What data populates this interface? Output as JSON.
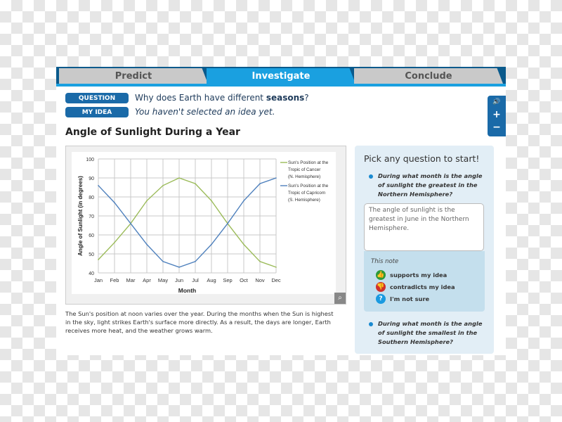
{
  "tabs": [
    {
      "label": "Predict",
      "active": false
    },
    {
      "label": "Investigate",
      "active": true
    },
    {
      "label": "Conclude",
      "active": false
    }
  ],
  "question": {
    "badge": "QUESTION",
    "text_pre": "Why does Earth have different ",
    "text_bold": "seasons",
    "text_post": "?"
  },
  "idea": {
    "badge": "MY IDEA",
    "text": "You haven't selected an idea yet."
  },
  "controls": {
    "audio": "🔊",
    "zoom_in": "+",
    "zoom_out": "−"
  },
  "section_title": "Angle of Sunlight During a Year",
  "description": "The Sun's position at noon varies over the year. During the months when the Sun is highest in the sky, light strikes Earth's surface more directly. As a result, the days are longer, Earth receives more heat, and the weather grows warm.",
  "chart_data": {
    "type": "line",
    "categories": [
      "Jan",
      "Feb",
      "Mar",
      "Apr",
      "May",
      "Jun",
      "Jul",
      "Aug",
      "Sep",
      "Oct",
      "Nov",
      "Dec"
    ],
    "xlabel": "Month",
    "ylabel": "Angle of Sunlight (in degrees)",
    "ylim": [
      40,
      100
    ],
    "yticks": [
      40,
      50,
      60,
      70,
      80,
      90,
      100
    ],
    "grid": true,
    "legend": "right",
    "series": [
      {
        "name_lines": [
          "Sun's Position at the",
          "Tropic of Cancer",
          "(N. Hemisphere)"
        ],
        "color": "#9bbb59",
        "values": [
          47,
          56,
          66,
          78,
          86,
          90,
          87,
          78,
          66,
          55,
          46,
          43
        ]
      },
      {
        "name_lines": [
          "Sun's Position at the",
          "Tropic of Capricorn",
          "(S. Hemisphere)"
        ],
        "color": "#4f81bd",
        "values": [
          86,
          77,
          66,
          55,
          46,
          43,
          46,
          55,
          66,
          78,
          87,
          90
        ]
      }
    ]
  },
  "sidebar": {
    "heading": "Pick any question to start!",
    "q1": "During what month is the angle of sunlight the greatest in the Northern Hemisphere?",
    "note": "The angle of sunlight is the greatest in June in the Northern Hemisphere.",
    "note_label": "This note",
    "options": [
      {
        "label": "supports my idea",
        "color": "#2e9a3a",
        "icon": "👍"
      },
      {
        "label": "contradicts my idea",
        "color": "#d0312d",
        "icon": "👎"
      },
      {
        "label": "I'm not sure",
        "color": "#1a9ae0",
        "icon": "?"
      }
    ],
    "q2": "During what month is the angle of sunlight the smallest in the Southern Hemisphere?"
  }
}
